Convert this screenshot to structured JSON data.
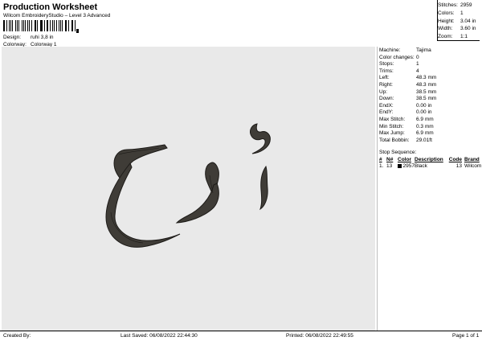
{
  "header": {
    "title": "Production Worksheet",
    "subtitle": "Wilcom EmbroideryStudio – Level 3 Advanced"
  },
  "design_info": [
    {
      "label": "Design:",
      "value": "ruhi 3,8 in"
    },
    {
      "label": "Colorway:",
      "value": "Colorway 1"
    }
  ],
  "summary": [
    {
      "label": "Stitches:",
      "value": "2959"
    },
    {
      "label": "Colors:",
      "value": "1"
    },
    {
      "label": "Height:",
      "value": "3.04 in"
    },
    {
      "label": "Width:",
      "value": "3.60 in"
    },
    {
      "label": "Zoom:",
      "value": "1:1"
    }
  ],
  "properties": [
    {
      "label": "Machine:",
      "value": "Tajima"
    },
    {
      "label": "Color changes:",
      "value": "0"
    },
    {
      "label": "Stops:",
      "value": "1"
    },
    {
      "label": "Trims:",
      "value": "4"
    },
    {
      "label": "Left:",
      "value": "48.3 mm"
    },
    {
      "label": "Right:",
      "value": "48.3 mm"
    },
    {
      "label": "Up:",
      "value": "38.5 mm"
    },
    {
      "label": "Down:",
      "value": "38.5 mm"
    },
    {
      "label": "EndX:",
      "value": "0.00 in"
    },
    {
      "label": "EndY:",
      "value": "0.00 in"
    },
    {
      "label": "Max Stitch:",
      "value": "6.9 mm"
    },
    {
      "label": "Min Stitch:",
      "value": "0.3 mm"
    },
    {
      "label": "Max Jump:",
      "value": "6.9 mm"
    },
    {
      "label": "Total Bobbin:",
      "value": "29.01ft"
    }
  ],
  "stop_sequence": {
    "title": "Stop Sequence:",
    "headers": {
      "num": "#",
      "n": "N#",
      "color": "Color",
      "description": "Description",
      "code": "Code",
      "brand": "Brand"
    },
    "rows": [
      {
        "idx": "1.",
        "n": "13",
        "color_code": "2957",
        "swatch": "#000000",
        "description": "Black",
        "code": "13",
        "brand": "Wilcom"
      }
    ]
  },
  "design": {
    "thread_color": "#3f3c37",
    "outline_color": "#1d1b18"
  },
  "footer": {
    "created": "Created By:",
    "saved": "Last Saved: 06/08/2022 22:44:30",
    "printed": "Printed: 06/08/2022 22:49:55",
    "page": "Page 1 of 1"
  }
}
